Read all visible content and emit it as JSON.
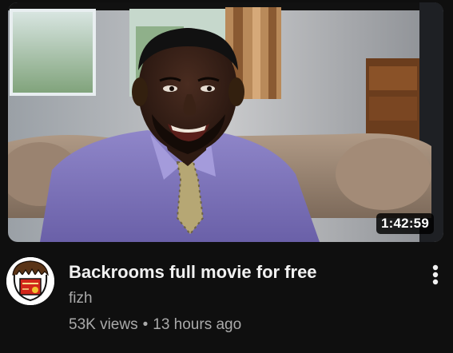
{
  "video": {
    "duration": "1:42:59",
    "title": "Backrooms full movie for free",
    "channel": "fizh",
    "views": "53K views",
    "separator": "•",
    "age": "13 hours ago",
    "thumbnail_icon": "movie-scene-thumbnail",
    "menu_icon": "more-vert-icon"
  },
  "colors": {
    "background": "#0f0f0f",
    "title": "#f1f1f1",
    "secondary_text": "#aaaaaa",
    "avatar_logo": "#d1261a"
  }
}
